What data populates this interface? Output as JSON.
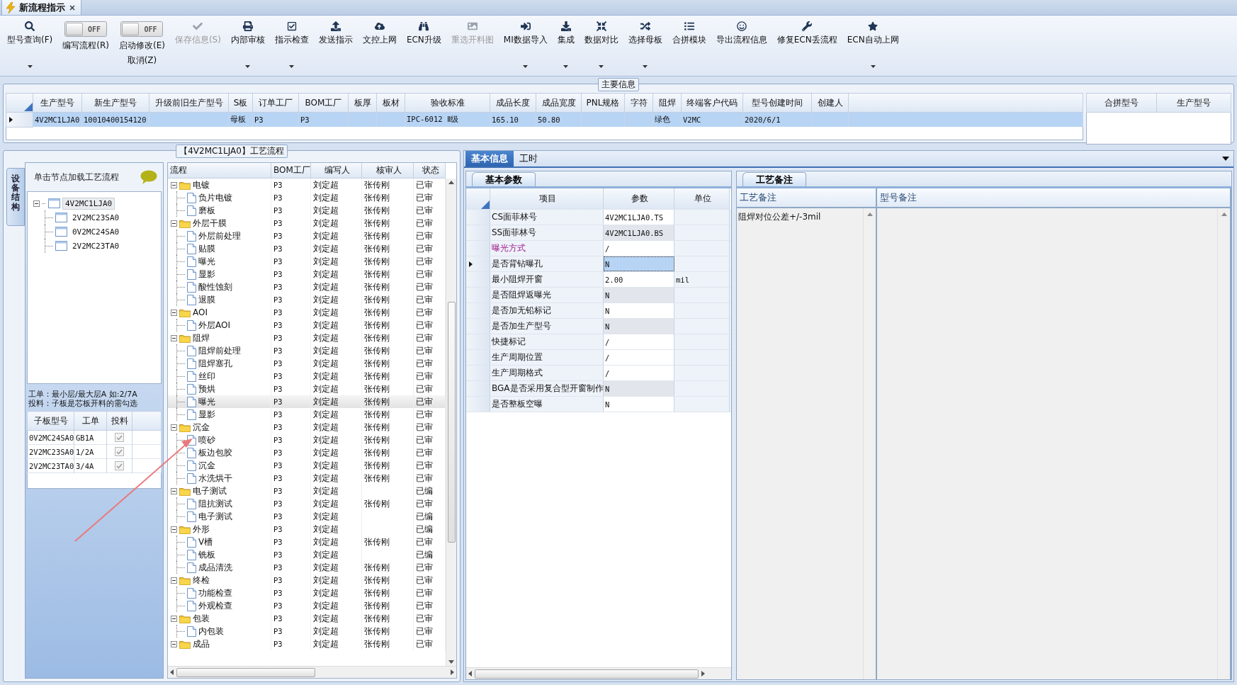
{
  "tab": {
    "title": "新流程指示",
    "closable": true
  },
  "toolbar": [
    {
      "kind": "button",
      "label": "型号查询(F)",
      "dropdown": true,
      "disabled": false
    },
    {
      "kind": "toggle",
      "state_text": "OFF",
      "on": false,
      "lines": [
        "编写流程(R)"
      ]
    },
    {
      "kind": "toggle",
      "state_text": "OFF",
      "on": false,
      "lines": [
        "启动修改(E)",
        "取消(Z)"
      ]
    },
    {
      "kind": "button",
      "label": "保存信息(S)",
      "dropdown": false,
      "disabled": true
    },
    {
      "kind": "button",
      "label": "内部审核",
      "dropdown": true,
      "disabled": false
    },
    {
      "kind": "button",
      "label": "指示检查",
      "dropdown": true,
      "disabled": false
    },
    {
      "kind": "button",
      "label": "发送指示",
      "dropdown": false,
      "disabled": false
    },
    {
      "kind": "button",
      "label": "文控上网",
      "dropdown": false,
      "disabled": false
    },
    {
      "kind": "button",
      "label": "ECN升级",
      "dropdown": false,
      "disabled": false
    },
    {
      "kind": "button",
      "label": "重选开料图",
      "dropdown": false,
      "disabled": true
    },
    {
      "kind": "button",
      "label": "MI数据导入",
      "dropdown": true,
      "disabled": false
    },
    {
      "kind": "button",
      "label": "集成",
      "dropdown": true,
      "disabled": false
    },
    {
      "kind": "button",
      "label": "数据对比",
      "dropdown": true,
      "disabled": false
    },
    {
      "kind": "button",
      "label": "选择母板",
      "dropdown": true,
      "disabled": false
    },
    {
      "kind": "button",
      "label": "合拼模块",
      "dropdown": false,
      "disabled": false
    },
    {
      "kind": "button",
      "label": "导出流程信息",
      "dropdown": false,
      "disabled": false
    },
    {
      "kind": "button",
      "label": "修复ECN丢流程",
      "dropdown": false,
      "disabled": false
    },
    {
      "kind": "button",
      "label": "ECN自动上网",
      "dropdown": true,
      "disabled": false
    }
  ],
  "main_info": {
    "title": "主要信息",
    "columns": [
      "生产型号",
      "新生产型号",
      "升级前旧生产型号",
      "S板",
      "订单工厂",
      "BOM工厂",
      "板厚",
      "板材",
      "验收标准",
      "成品长度",
      "成品宽度",
      "PNL规格",
      "字符",
      "阻焊",
      "终端客户代码",
      "型号创建时间",
      "创建人"
    ],
    "rows": [
      {
        "selected": true,
        "cells": [
          "4V2MC1LJA0",
          "10010400154120",
          null,
          "母板",
          "P3",
          "P3",
          null,
          null,
          "IPC-6012 Ⅱ级",
          "165.10",
          "50.80",
          null,
          null,
          "绿色",
          "V2MC",
          "2020/6/1",
          null
        ]
      }
    ],
    "merge_columns": [
      "合拼型号",
      "生产型号"
    ]
  },
  "process_panel": {
    "title": "【4V2MC1LJA0】工艺流程",
    "side_tab": "设备结构",
    "structure": {
      "hint": "单击节点加载工艺流程",
      "tree": [
        {
          "label": "4V2MC1LJA0",
          "expanded": true,
          "selected": true,
          "children": [
            {
              "label": "2V2MC23SA0",
              "selected": false
            },
            {
              "label": "0V2MC24SA0",
              "selected": false
            },
            {
              "label": "2V2MC23TA0",
              "selected": false
            }
          ]
        }
      ]
    },
    "notes": [
      "工单：最小层/最大层A 如:2/7A",
      "投料：子板是芯板开料的需勾选"
    ],
    "sub_boards": {
      "columns": [
        "子板型号",
        "工单",
        "投料"
      ],
      "rows": [
        {
          "cells": [
            "0V2MC24SA0",
            "GB1A"
          ],
          "checked": true
        },
        {
          "cells": [
            "2V2MC23SA0",
            "1/2A"
          ],
          "checked": true
        },
        {
          "cells": [
            "2V2MC23TA0",
            "3/4A"
          ],
          "checked": true
        }
      ]
    },
    "flow": {
      "columns": [
        "流程",
        "BOM工厂",
        "编写人",
        "核审人",
        "状态"
      ],
      "rows": [
        {
          "label": "电镀",
          "expanded": true,
          "selected": false,
          "bom": "P3",
          "writer": "刘定超",
          "reviewer": "张传刚",
          "status": "已审",
          "children": [
            {
              "label": "负片电镀",
              "selected": false,
              "bom": "P3",
              "writer": "刘定超",
              "reviewer": "张传刚",
              "status": "已审"
            },
            {
              "label": "磨板",
              "selected": false,
              "bom": "P3",
              "writer": "刘定超",
              "reviewer": "张传刚",
              "status": "已审"
            }
          ]
        },
        {
          "label": "外层干膜",
          "expanded": true,
          "selected": false,
          "bom": "P3",
          "writer": "刘定超",
          "reviewer": "张传刚",
          "status": "已审",
          "children": [
            {
              "label": "外层前处理",
              "selected": false,
              "bom": "P3",
              "writer": "刘定超",
              "reviewer": "张传刚",
              "status": "已审"
            },
            {
              "label": "贴膜",
              "selected": false,
              "bom": "P3",
              "writer": "刘定超",
              "reviewer": "张传刚",
              "status": "已审"
            },
            {
              "label": "曝光",
              "selected": false,
              "bom": "P3",
              "writer": "刘定超",
              "reviewer": "张传刚",
              "status": "已审"
            },
            {
              "label": "显影",
              "selected": false,
              "bom": "P3",
              "writer": "刘定超",
              "reviewer": "张传刚",
              "status": "已审"
            },
            {
              "label": "酸性蚀刻",
              "selected": false,
              "bom": "P3",
              "writer": "刘定超",
              "reviewer": "张传刚",
              "status": "已审"
            },
            {
              "label": "退膜",
              "selected": false,
              "bom": "P3",
              "writer": "刘定超",
              "reviewer": "张传刚",
              "status": "已审"
            }
          ]
        },
        {
          "label": "AOI",
          "expanded": true,
          "selected": false,
          "bom": "P3",
          "writer": "刘定超",
          "reviewer": "张传刚",
          "status": "已审",
          "children": [
            {
              "label": "外层AOI",
              "selected": false,
              "bom": "P3",
              "writer": "刘定超",
              "reviewer": "张传刚",
              "status": "已审"
            }
          ]
        },
        {
          "label": "阻焊",
          "expanded": true,
          "selected": false,
          "bom": "P3",
          "writer": "刘定超",
          "reviewer": "张传刚",
          "status": "已审",
          "children": [
            {
              "label": "阻焊前处理",
              "selected": false,
              "bom": "P3",
              "writer": "刘定超",
              "reviewer": "张传刚",
              "status": "已审"
            },
            {
              "label": "阻焊塞孔",
              "selected": false,
              "bom": "P3",
              "writer": "刘定超",
              "reviewer": "张传刚",
              "status": "已审"
            },
            {
              "label": "丝印",
              "selected": false,
              "bom": "P3",
              "writer": "刘定超",
              "reviewer": "张传刚",
              "status": "已审"
            },
            {
              "label": "预烘",
              "selected": false,
              "bom": "P3",
              "writer": "刘定超",
              "reviewer": "张传刚",
              "status": "已审"
            },
            {
              "label": "曝光",
              "selected": true,
              "bom": "P3",
              "writer": "刘定超",
              "reviewer": "张传刚",
              "status": "已审"
            },
            {
              "label": "显影",
              "selected": false,
              "bom": "P3",
              "writer": "刘定超",
              "reviewer": "张传刚",
              "status": "已审"
            }
          ]
        },
        {
          "label": "沉金",
          "expanded": true,
          "selected": false,
          "bom": "P3",
          "writer": "刘定超",
          "reviewer": "张传刚",
          "status": "已审",
          "children": [
            {
              "label": "喷砂",
              "selected": false,
              "bom": "P3",
              "writer": "刘定超",
              "reviewer": "张传刚",
              "status": "已审"
            },
            {
              "label": "板边包胶",
              "selected": false,
              "bom": "P3",
              "writer": "刘定超",
              "reviewer": "张传刚",
              "status": "已审"
            },
            {
              "label": "沉金",
              "selected": false,
              "bom": "P3",
              "writer": "刘定超",
              "reviewer": "张传刚",
              "status": "已审"
            },
            {
              "label": "水洗烘干",
              "selected": false,
              "bom": "P3",
              "writer": "刘定超",
              "reviewer": "张传刚",
              "status": "已审"
            }
          ]
        },
        {
          "label": "电子测试",
          "expanded": true,
          "selected": false,
          "bom": "P3",
          "writer": "刘定超",
          "status": "已编",
          "children": [
            {
              "label": "阻抗测试",
              "selected": false,
              "bom": "P3",
              "writer": "刘定超",
              "reviewer": "张传刚",
              "status": "已审"
            },
            {
              "label": "电子测试",
              "selected": false,
              "bom": "P3",
              "writer": "刘定超",
              "status": "已编"
            }
          ]
        },
        {
          "label": "外形",
          "expanded": true,
          "selected": false,
          "bom": "P3",
          "writer": "刘定超",
          "status": "已编",
          "children": [
            {
              "label": "V槽",
              "selected": false,
              "bom": "P3",
              "writer": "刘定超",
              "reviewer": "张传刚",
              "status": "已审"
            },
            {
              "label": "铣板",
              "selected": false,
              "bom": "P3",
              "writer": "刘定超",
              "status": "已编"
            },
            {
              "label": "成品清洗",
              "selected": false,
              "bom": "P3",
              "writer": "刘定超",
              "reviewer": "张传刚",
              "status": "已审"
            }
          ]
        },
        {
          "label": "终检",
          "expanded": true,
          "selected": false,
          "bom": "P3",
          "writer": "刘定超",
          "reviewer": "张传刚",
          "status": "已审",
          "children": [
            {
              "label": "功能检查",
              "selected": false,
              "bom": "P3",
              "writer": "刘定超",
              "reviewer": "张传刚",
              "status": "已审"
            },
            {
              "label": "外观检查",
              "selected": false,
              "bom": "P3",
              "writer": "刘定超",
              "reviewer": "张传刚",
              "status": "已审"
            }
          ]
        },
        {
          "label": "包装",
          "expanded": true,
          "selected": false,
          "bom": "P3",
          "writer": "刘定超",
          "reviewer": "张传刚",
          "status": "已审",
          "children": [
            {
              "label": "内包装",
              "selected": false,
              "bom": "P3",
              "writer": "刘定超",
              "reviewer": "张传刚",
              "status": "已审"
            }
          ]
        },
        {
          "label": "成品",
          "expanded": true,
          "selected": false,
          "bom": "P3",
          "writer": "刘定超",
          "reviewer": "张传刚",
          "status": "已审"
        }
      ]
    }
  },
  "detail": {
    "tabs": [
      {
        "label": "基本信息",
        "selected": true
      },
      {
        "label": "工时",
        "selected": false
      }
    ],
    "params": {
      "title": "基本参数",
      "columns": [
        "项目",
        "参数",
        "单位"
      ],
      "rows": [
        {
          "item": "CS面菲林号",
          "value": "4V2MC1LJA0.TS",
          "editable": true,
          "current": false,
          "emphasized": false
        },
        {
          "item": "SS面菲林号",
          "value": "4V2MC1LJA0.BS",
          "editable": false,
          "current": false,
          "emphasized": false
        },
        {
          "item": "曝光方式",
          "value": "/",
          "editable": true,
          "current": false,
          "emphasized": true
        },
        {
          "item": "是否背钻曝孔",
          "value": "N",
          "editable": true,
          "current": true,
          "emphasized": false
        },
        {
          "item": "最小阻焊开窗",
          "value": "2.00",
          "unit": "mil",
          "editable": true,
          "current": false,
          "emphasized": false
        },
        {
          "item": "是否阻焊返曝光",
          "value": "N",
          "editable": false,
          "current": false,
          "emphasized": false
        },
        {
          "item": "是否加无铅标记",
          "value": "N",
          "editable": true,
          "current": false,
          "emphasized": false
        },
        {
          "item": "是否加生产型号",
          "value": "N",
          "editable": false,
          "current": false,
          "emphasized": false
        },
        {
          "item": "快捷标记",
          "value": "/",
          "editable": true,
          "current": false,
          "emphasized": false
        },
        {
          "item": "生产周期位置",
          "value": "/",
          "editable": true,
          "current": false,
          "emphasized": false
        },
        {
          "item": "生产周期格式",
          "value": "/",
          "editable": true,
          "current": false,
          "emphasized": false
        },
        {
          "item": "BGA是否采用复合型开窗制作",
          "value": "N",
          "editable": false,
          "current": false,
          "emphasized": false
        },
        {
          "item": "是否整板空曝",
          "value": "N",
          "editable": true,
          "current": false,
          "emphasized": false
        }
      ]
    },
    "remarks": {
      "title": "工艺备注",
      "columns": [
        "工艺备注",
        "型号备注"
      ],
      "cells": [
        "阻焊对位公差+/-3mil"
      ]
    }
  }
}
